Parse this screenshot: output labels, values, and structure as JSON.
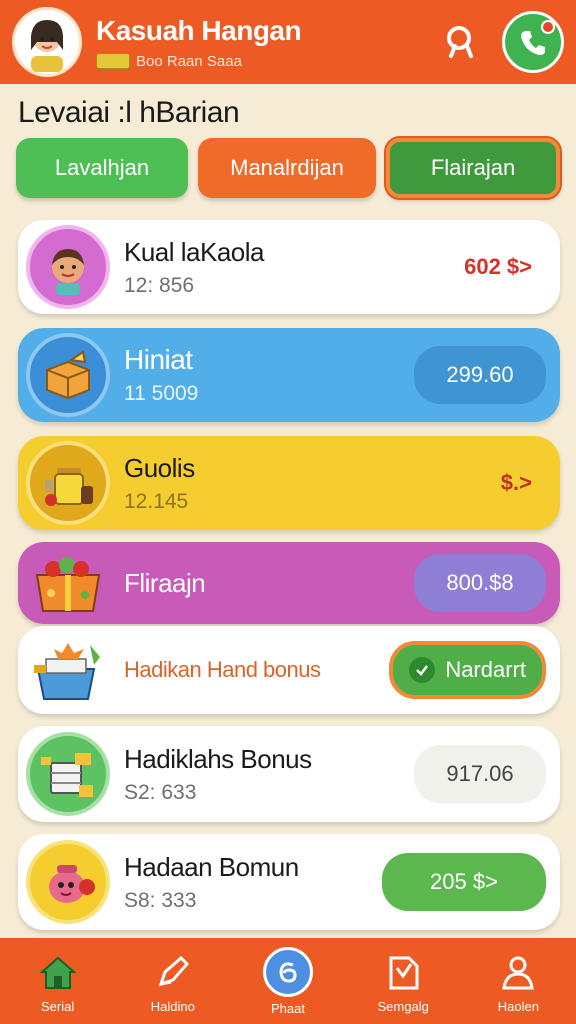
{
  "header": {
    "title": "Kasuah Hangan",
    "subtitle": "Boo Raan Saaa"
  },
  "section_title": "Levaiai :l hBarian",
  "tabs": [
    {
      "label": "Lavalhjan"
    },
    {
      "label": "Manalrdijan"
    },
    {
      "label": "Flairajan"
    }
  ],
  "cards": [
    {
      "title": "Kual laKaola",
      "sub": "12: 856",
      "value": "602 $>"
    },
    {
      "title": "Hiniat",
      "sub": "11 5009",
      "value": "299.60"
    },
    {
      "title": "Guolis",
      "sub": "12.145",
      "value": "$.>"
    },
    {
      "title": "Fliraajn",
      "sub": "",
      "value": "800.$8"
    },
    {
      "title": "Hadikan Hand bonus",
      "sub": "",
      "value": "Nardarrt"
    },
    {
      "title": "Hadiklahs Bonus",
      "sub": "S2: 633",
      "value": "917.06"
    },
    {
      "title": "Hadaan Bomun",
      "sub": "S8: 333",
      "value": "205 $>"
    }
  ],
  "nav": [
    {
      "label": "Serial",
      "icon": "home-icon"
    },
    {
      "label": "Haldino",
      "icon": "pencil-icon"
    },
    {
      "label": "Phaat",
      "icon": "coin-icon"
    },
    {
      "label": "Semgalg",
      "icon": "note-icon"
    },
    {
      "label": "Haolen",
      "icon": "person-icon"
    }
  ],
  "colors": {
    "primary": "#ee5a24",
    "background": "#f6ecd6",
    "green": "#4dbf55",
    "blue": "#52aee8",
    "yellow": "#f5cd2f",
    "purple": "#c85ab8"
  }
}
